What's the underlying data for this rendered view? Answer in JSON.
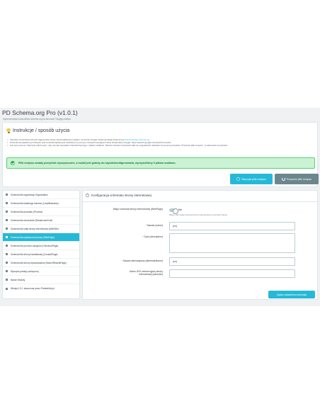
{
  "header": {
    "title": "PD Schema.org Pro (v1.0.1)",
    "subtitle": "Implementacja znaczników schema.org na stronach Twojego sklepu"
  },
  "instructions": {
    "title": "Instrukcje / sposób użycia",
    "items": [
      "Sposoby oznaczania różnych fragmentów strony są kompleksowo opisane na stronie Google: Dokumentacja schema.org",
      "Kontrola wprowadzonych danych oraz kontrola błędów jest możliwa przy pomocy narzędzi testujących dane strukturalne Google: https://search.google.com/test/rich-results",
      "Lub przy pomocy \"Wyczyść pliki tempu\", aby usunąć wszystkie znaczniki itemtype z plików szablonu. Możesz również przywrócić pliki do oryginalnych ustawień za pomocą przycisku \"Przywróć pliki motywu\", w zależności od potrzeb."
    ],
    "link_text": "Dokumentacja schema.org",
    "alert": "Pliki motywu zostały pomyślnie wyczyszczone, a moduł jest gotowy do użycia/skonfigurowania, wyczyściliśmy 5 plików szablonu.",
    "clean_button": "Wyczyść pliki motywu",
    "restore_button": "Przywróć pliki motywu"
  },
  "sidebar": {
    "items": [
      {
        "label": "Schemat dla organizacji Organization",
        "active": false
      },
      {
        "label": "Schemat dla lokalnego biznesu (LocalBusiness)",
        "active": false
      },
      {
        "label": "Schemat dla produktu (Product)",
        "active": false
      },
      {
        "label": "Schemat dla okruszków (BreadcrumbList)",
        "active": false
      },
      {
        "label": "Schemat dla całej strony internetowej (WebSite)",
        "active": false
      },
      {
        "label": "Schemat dla pojedynczej strony (WebPage)",
        "active": true
      },
      {
        "label": "Schemat dla procesu zakupów (CheckoutPage)",
        "active": false
      },
      {
        "label": "Schemat dla strony kontaktowej (ContactPage)",
        "active": false
      },
      {
        "label": "Schemat dla strony wyszukiwania (SearchResultsPage)",
        "active": false
      },
      {
        "label": "Wyczyść pamięć podręczną",
        "active": false
      },
      {
        "label": "Nasze Moduły",
        "active": false
      },
      {
        "label": "Wersja 1.0.1 stworzona przez PrestaHelp.pl",
        "active": false
      }
    ]
  },
  "config": {
    "title": "Konfiguracja schematu strony internetowej",
    "enable_label": "Włącz schemat strony internetowej (WebPage)",
    "enable_value": "Nie",
    "enable_help": "Włącz, aby dodać schemat strony internetowej na stronach sklepu.",
    "name_label": "Nazwa (name)",
    "name_value": "(en)",
    "description_label": "Opis (description)",
    "alt_name_label": "Nazwa alternatywna (alternateName)",
    "alt_name_value": "(en)",
    "sameas_label": "Adres URL referencyjnej strony internetowej (sameAs)",
    "save_button": "Zapisz ustawienia schematu"
  },
  "colors": {
    "accent": "#25b9d7",
    "success": "#53d572",
    "secondary": "#6c868e"
  }
}
